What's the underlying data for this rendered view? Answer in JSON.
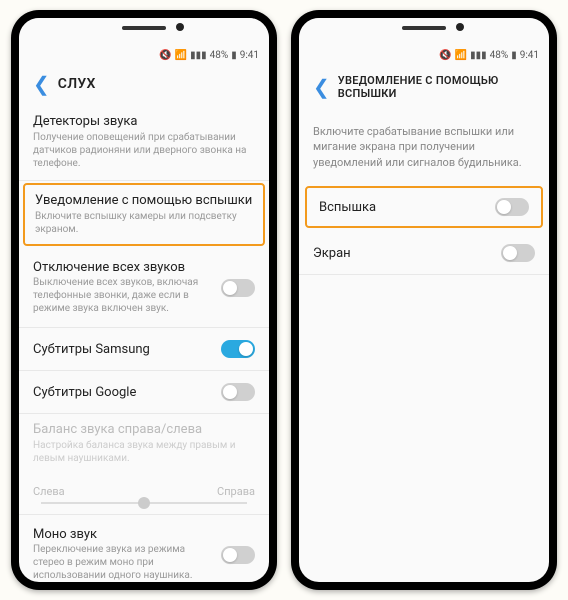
{
  "status": {
    "battery": "48%",
    "time": "9:41"
  },
  "left": {
    "title": "СЛУХ",
    "detectors": {
      "title": "Детекторы звука",
      "desc": "Получение оповещений при срабатывании датчиков радионяни или дверного звонка на телефоне."
    },
    "flashNotify": {
      "title": "Уведомление с помощью вспышки",
      "desc": "Включите вспышку камеры или подсветку экраном."
    },
    "muteAll": {
      "title": "Отключение всех звуков",
      "desc": "Выключение всех звуков, включая телефонные звонки, даже если в режиме звука включен звук."
    },
    "subsSamsung": "Субтитры Samsung",
    "subsGoogle": "Субтитры Google",
    "balance": {
      "title": "Баланс звука справа/слева",
      "desc": "Настройка баланса звука между правым и левым наушниками.",
      "left": "Слева",
      "right": "Справа"
    },
    "mono": {
      "title": "Моно звук",
      "desc": "Переключение звука из режима стерео в режим моно при использовании одного наушника."
    }
  },
  "right": {
    "title": "УВЕДОМЛЕНИЕ С ПОМОЩЬЮ ВСПЫШКИ",
    "desc": "Включите срабатывание вспышки или мигание экрана при получении уведомлений или сигналов будильника.",
    "flash": "Вспышка",
    "screen": "Экран"
  }
}
